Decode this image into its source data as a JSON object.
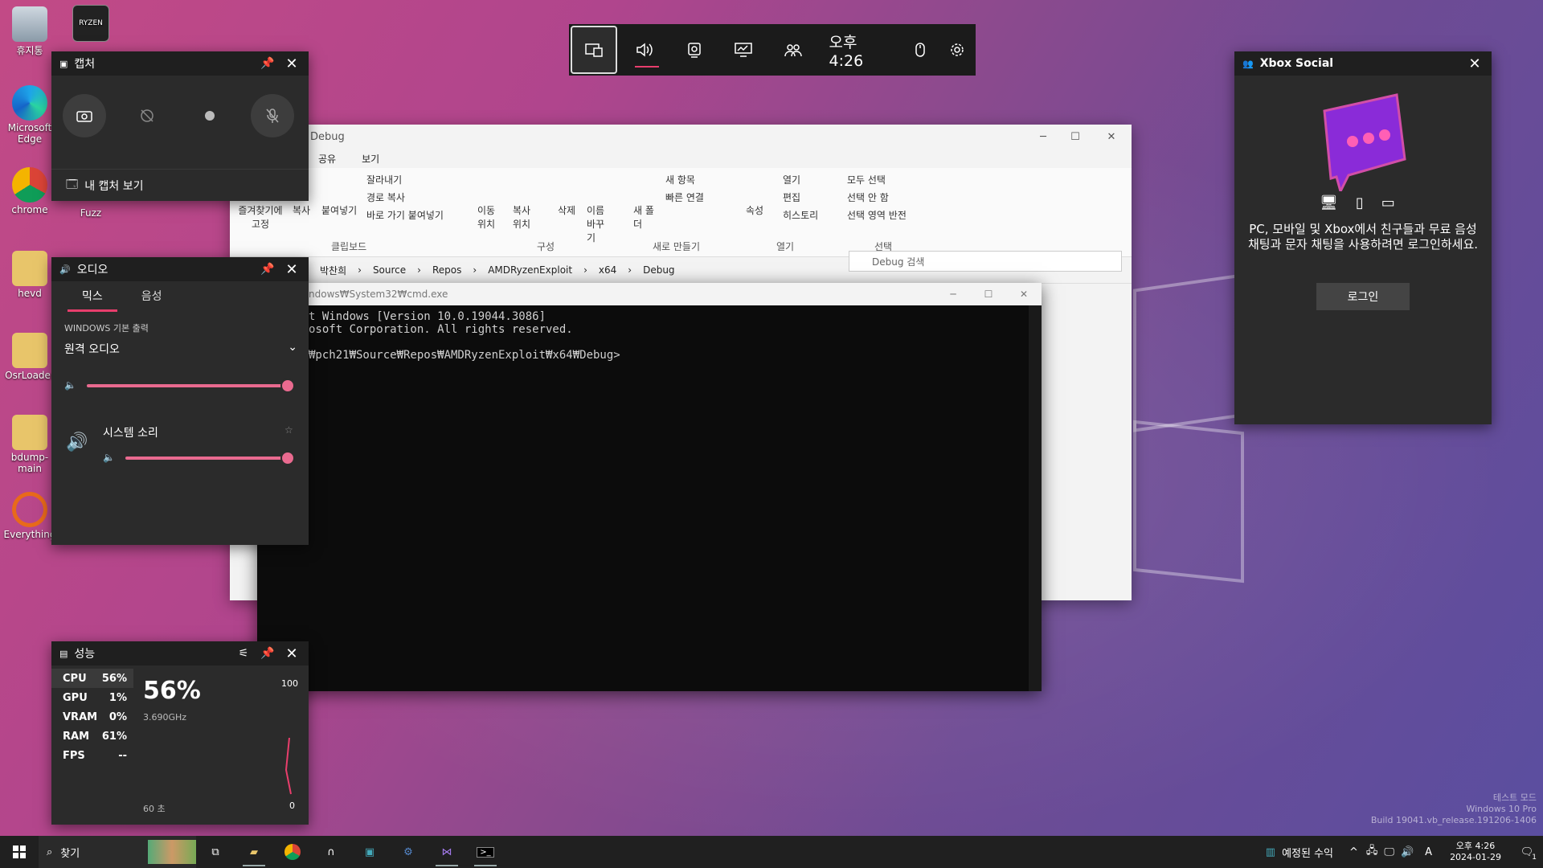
{
  "desktop": {
    "icons": [
      {
        "label": "휴지통"
      },
      {
        "label": "Microsoft Edge"
      },
      {
        "label": "chrome"
      },
      {
        "label": "hevd"
      },
      {
        "label": "OsrLoader"
      },
      {
        "label": "bdump-main"
      },
      {
        "label": "Everything"
      },
      {
        "label": "RYZEN"
      },
      {
        "label": "Fuzz"
      }
    ],
    "watermark": {
      "line1": "테스트 모드",
      "line2": "Windows 10 Pro",
      "line3": "Build 19041.vb_release.191206-1406"
    }
  },
  "gamebar": {
    "clock": "오후 4:26",
    "buttons": [
      "widget-menu",
      "audio",
      "capture",
      "performance",
      "xbox-social",
      "mouse",
      "settings"
    ]
  },
  "capture": {
    "title": "캡처",
    "see_captures": "내 캡처 보기"
  },
  "audio": {
    "title": "오디오",
    "tabs": [
      "믹스",
      "음성"
    ],
    "device_section": "WINDOWS 기본 출력",
    "device_name": "원격 오디오",
    "device_volume": 1.0,
    "app_name": "시스템 소리",
    "app_volume": 1.0
  },
  "performance": {
    "title": "성능",
    "rows": [
      {
        "name": "CPU",
        "value": "56%"
      },
      {
        "name": "GPU",
        "value": "1%"
      },
      {
        "name": "VRAM",
        "value": "0%"
      },
      {
        "name": "RAM",
        "value": "61%"
      },
      {
        "name": "FPS",
        "value": "--"
      }
    ],
    "big_value": "56%",
    "freq": "3.690GHz",
    "scale_max": "100",
    "scale_min": "0",
    "timespan": "60 초"
  },
  "xbox_social": {
    "title": "Xbox Social",
    "message": "PC, 모바일 및 Xbox에서 친구들과 무료 음성 채팅과 문자 채팅을 사용하려면 로그인하세요.",
    "login": "로그인"
  },
  "explorer": {
    "title": "Debug",
    "tabs": [
      "공유",
      "보기"
    ],
    "ribbon": {
      "pin": "즐겨찾기에 고정",
      "copy": "복사",
      "paste": "붙여넣기",
      "cut": "잘라내기",
      "copy_path": "경로 복사",
      "paste_shortcut": "바로 가기 붙여넣기",
      "clipboard": "클립보드",
      "move_to": "이동 위치",
      "copy_to": "복사 위치",
      "delete": "삭제",
      "rename": "이름 바꾸기",
      "organize": "구성",
      "new_folder": "새 폴더",
      "new_item": "새 항목",
      "quick_access": "빠른 연결",
      "new": "새로 만들기",
      "properties": "속성",
      "open": "열기",
      "edit": "편집",
      "history": "히스토리",
      "open_group": "열기",
      "select_all": "모두 선택",
      "select_none": "선택 안 함",
      "invert": "선택 영역 반전",
      "select": "선택"
    },
    "breadcrumb": [
      "박찬희",
      "Source",
      "Repos",
      "AMDRyzenExploit",
      "x64",
      "Debug"
    ],
    "search_placeholder": "Debug 검색"
  },
  "cmd": {
    "title": "ndows₩System32₩cmd.exe",
    "lines": [
      "t Windows [Version 10.0.19044.3086]",
      "osoft Corporation. All rights reserved.",
      "",
      "₩pch21₩Source₩Repos₩AMDRyzenExploit₩x64₩Debug>"
    ]
  },
  "taskbar": {
    "search": "찾기",
    "tray_label": "예정된 수익",
    "time": "오후 4:26",
    "date": "2024-01-29",
    "ime": "A",
    "notification_count": "1"
  }
}
